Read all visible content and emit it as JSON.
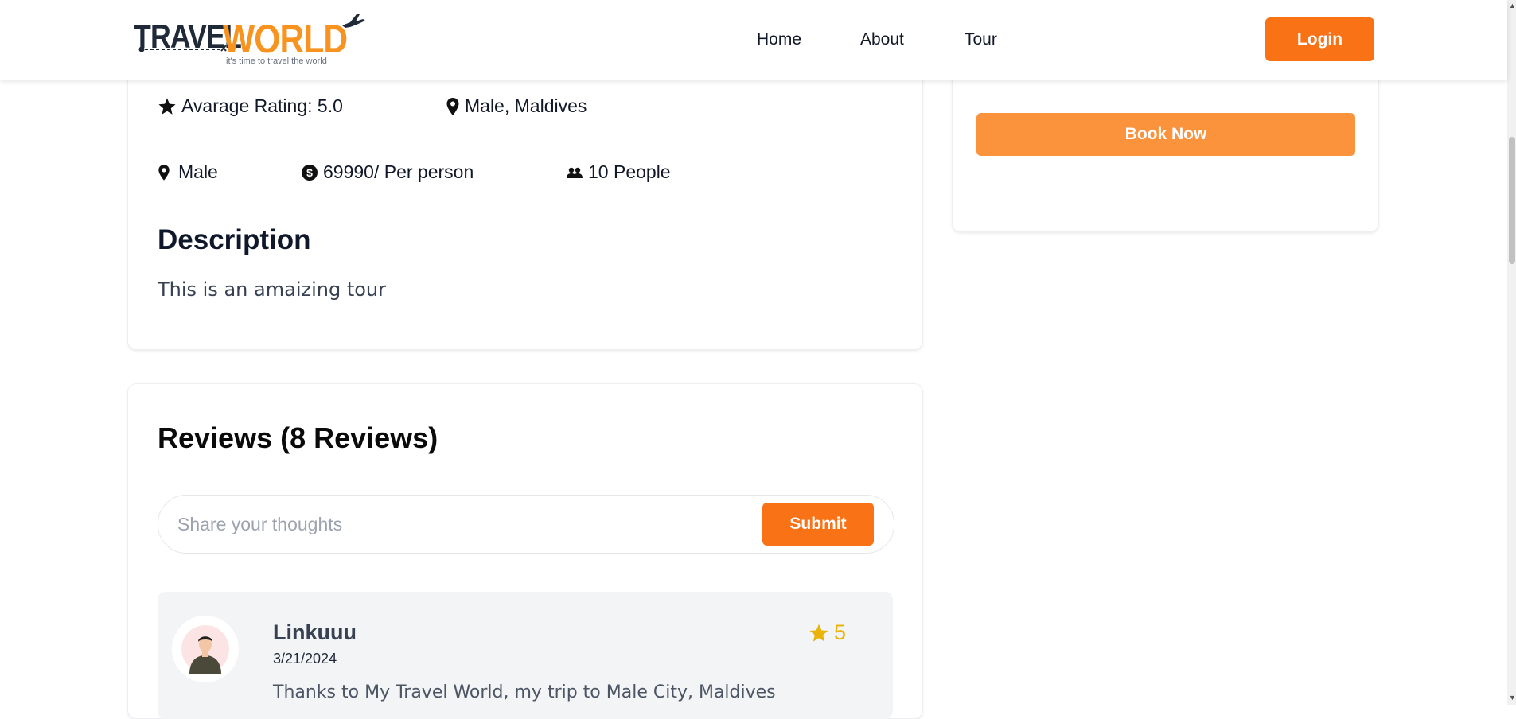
{
  "header": {
    "logo_travel": "TRAVEL",
    "logo_world": "WORLD",
    "logo_tagline": "it's time to travel the world",
    "nav": [
      {
        "label": "Home"
      },
      {
        "label": "About"
      },
      {
        "label": "Tour"
      }
    ],
    "login_label": "Login"
  },
  "tour": {
    "rating_label": "Avarage Rating: 5.0",
    "location": "Male, Maldives",
    "city": "Male",
    "price": "69990/ Per person",
    "group_size": "10 People",
    "description_title": "Description",
    "description_text": "This is an amaizing tour"
  },
  "booking": {
    "book_label": "Book Now"
  },
  "reviews": {
    "title": "Reviews (8 Reviews)",
    "input_placeholder": "Share your thoughts",
    "submit_label": "Submit",
    "items": [
      {
        "name": "Linkuuu",
        "date": "3/21/2024",
        "rating": "5",
        "text": "Thanks to My Travel World, my trip to Male City, Maldives"
      }
    ]
  },
  "colors": {
    "accent": "#f97316",
    "book_button": "#fb923c",
    "star": "#eab308"
  },
  "icons": [
    "star-icon",
    "location-pin-icon",
    "dollar-circle-icon",
    "people-icon",
    "plane-icon"
  ]
}
